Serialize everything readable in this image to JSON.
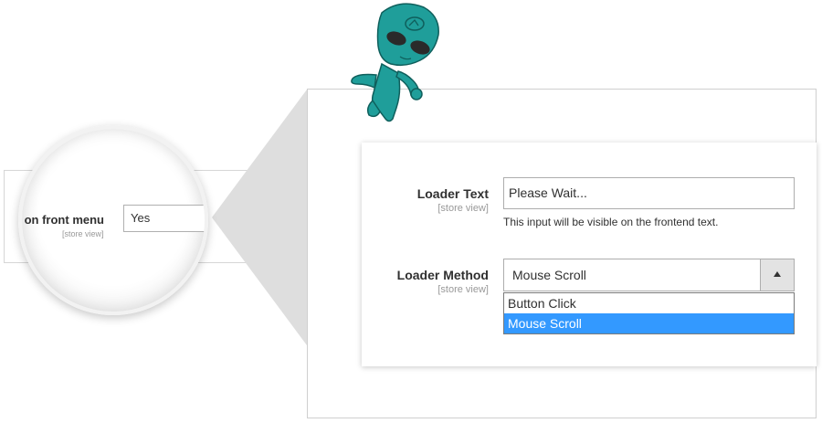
{
  "magnifier": {
    "label": "or  on front menu",
    "scope": "[store view]",
    "value": "Yes"
  },
  "loader_text": {
    "label": "Loader Text",
    "scope": "[store view]",
    "value": "Please Wait...",
    "note": "This input will be visible on the frontend text."
  },
  "loader_method": {
    "label": "Loader Method",
    "scope": "[store view]",
    "value": "Mouse Scroll",
    "options": [
      {
        "label": "Button Click"
      },
      {
        "label": "Mouse Scroll"
      }
    ],
    "selected_index": 1
  },
  "mascot": {
    "icon": "alien-mascot-icon",
    "color": "#1f9e9a"
  },
  "colors": {
    "highlight": "#3399ff",
    "wedge": "#dedede"
  }
}
